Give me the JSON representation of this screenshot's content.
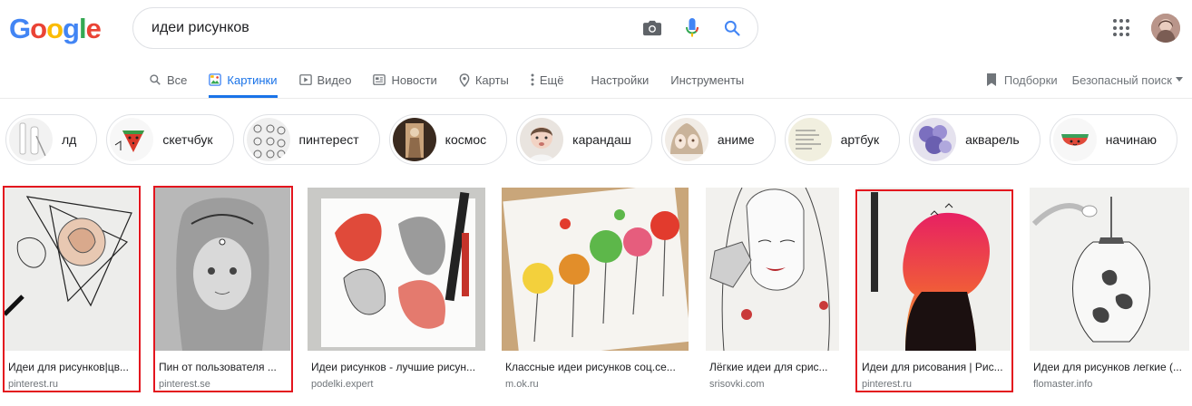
{
  "logo": {
    "letters": [
      "G",
      "o",
      "o",
      "g",
      "l",
      "e"
    ],
    "colors": [
      "#4285F4",
      "#EA4335",
      "#FBBC05",
      "#4285F4",
      "#34A853",
      "#EA4335"
    ]
  },
  "search": {
    "query": "идеи рисунков",
    "camera_icon": "camera-icon",
    "mic_icon": "mic-icon",
    "search_icon": "search-icon"
  },
  "tabs": [
    {
      "label": "Все",
      "icon": "search-icon"
    },
    {
      "label": "Картинки",
      "icon": "image-icon",
      "active": true
    },
    {
      "label": "Видео",
      "icon": "video-icon"
    },
    {
      "label": "Новости",
      "icon": "news-icon"
    },
    {
      "label": "Карты",
      "icon": "map-pin-icon"
    },
    {
      "label": "Ещё",
      "icon": "more-vert-icon"
    }
  ],
  "settings_label": "Настройки",
  "tools_label": "Инструменты",
  "collections_label": "Подборки",
  "safe_search_label": "Безопасный поиск",
  "chips": [
    {
      "label": "лд"
    },
    {
      "label": "скетчбук"
    },
    {
      "label": "пинтерест"
    },
    {
      "label": "космос"
    },
    {
      "label": "карандаш"
    },
    {
      "label": "аниме"
    },
    {
      "label": "артбук"
    },
    {
      "label": "акварель"
    },
    {
      "label": "начинаю"
    }
  ],
  "results": [
    {
      "title": "Идеи для рисунков|цв...",
      "source": "pinterest.ru",
      "highlighted": true
    },
    {
      "title": "Пин от пользователя ...",
      "source": "pinterest.se",
      "highlighted": true
    },
    {
      "title": "Идеи рисунков - лучшие рисун...",
      "source": "podelki.expert",
      "highlighted": false
    },
    {
      "title": "Классные идеи рисунков соц.се...",
      "source": "m.ok.ru",
      "highlighted": false
    },
    {
      "title": "Лёгкие идеи для срис...",
      "source": "srisovki.com",
      "highlighted": false
    },
    {
      "title": "Идеи для рисования | Рис...",
      "source": "pinterest.ru",
      "highlighted": true
    },
    {
      "title": "Идеи для рисунков легкие (...",
      "source": "flomaster.info",
      "highlighted": false
    }
  ],
  "colors": {
    "active_tab": "#1a73e8",
    "highlight_border": "#e3151e"
  }
}
